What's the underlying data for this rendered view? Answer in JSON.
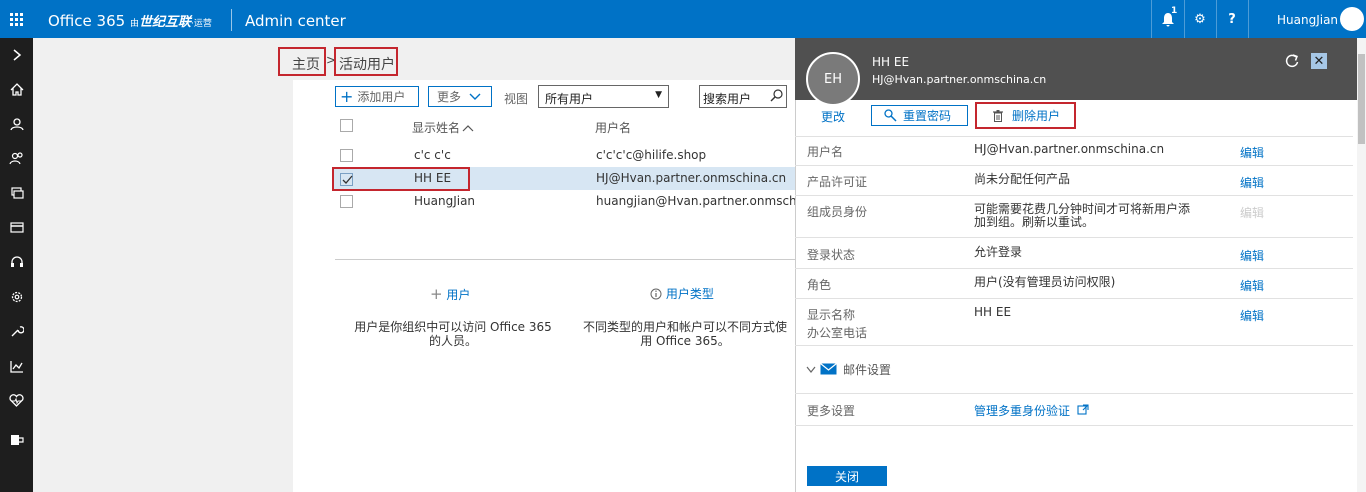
{
  "header": {
    "brand_product": "Office 365",
    "brand_by": "由",
    "brand_vendor": "世纪互联",
    "brand_operated": "运营",
    "app_title": "Admin center",
    "notification_count": "1",
    "help_label": "?",
    "user_name": "HuangJian",
    "color": "#0072c6"
  },
  "breadcrumb": {
    "home": "主页",
    "separator": ">",
    "current": "活动用户"
  },
  "toolbar": {
    "add_user": "添加用户",
    "more": "更多",
    "view_label": "视图",
    "view_value": "所有用户",
    "search_placeholder": "搜索用户"
  },
  "table": {
    "col_display_name": "显示姓名",
    "col_username": "用户名",
    "rows": [
      {
        "name": "c'c c'c",
        "username": "c'c'c'c@hilife.shop"
      },
      {
        "name": "HH EE",
        "username": "HJ@Hvan.partner.onmschina.cn"
      },
      {
        "name": "HuangJian",
        "username": "huangjian@Hvan.partner.onmschina"
      }
    ]
  },
  "info": {
    "user_title": "用户",
    "user_text": "用户是你组织中可以访问 Office 365 的人员。",
    "type_title": "用户类型",
    "type_text": "不同类型的用户和帐户可以不同方式使用 Office 365。"
  },
  "panel": {
    "initials": "EH",
    "name": "HH EE",
    "email": "HJ@Hvan.partner.onmschina.cn",
    "action_change": "更改",
    "action_reset": "重置密码",
    "action_delete": "删除用户",
    "edit_label": "编辑",
    "props": [
      {
        "label": "用户名",
        "value": "HJ@Hvan.partner.onmschina.cn"
      },
      {
        "label": "产品许可证",
        "value": "尚未分配任何产品"
      },
      {
        "label": "组成员身份",
        "value": "可能需要花费几分钟时间才可将新用户添加到组。刷新以重试。"
      },
      {
        "label": "登录状态",
        "value": "允许登录"
      },
      {
        "label": "角色",
        "value": "用户(没有管理员访问权限)"
      },
      {
        "label": "显示名称",
        "label2": "办公室电话",
        "value": "HH EE"
      }
    ],
    "mail_settings": "邮件设置",
    "more_settings_label": "更多设置",
    "more_settings_link": "管理多重身份验证",
    "close_button": "关闭"
  },
  "colors": {
    "accent": "#0072c6",
    "highlight_border": "#c4262e",
    "selected_row": "#d7e6f3",
    "panel_header": "#505050",
    "left_nav": "#1e1e1e"
  }
}
